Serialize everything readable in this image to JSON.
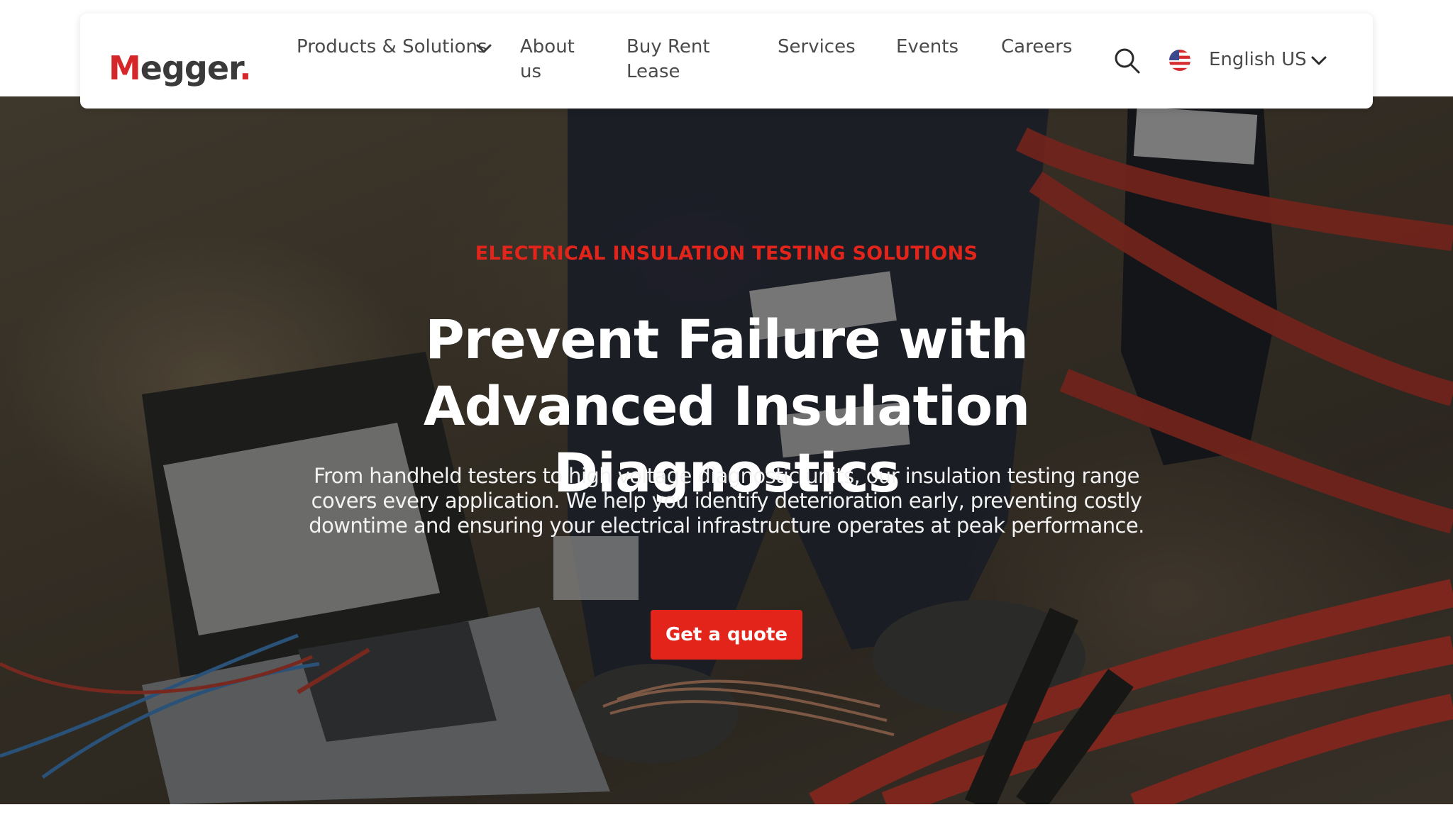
{
  "brand": {
    "logo_first": "M",
    "logo_rest": "egger",
    "logo_dot": ".",
    "accent_color": "#e3241b"
  },
  "nav": {
    "items": [
      {
        "label": "Products & Solutions",
        "has_dropdown": true
      },
      {
        "label_line1": "About",
        "label_line2": "us"
      },
      {
        "label_line1": "Buy Rent",
        "label_line2": "Lease"
      },
      {
        "label": "Services"
      },
      {
        "label": "Events"
      },
      {
        "label": "Careers"
      }
    ],
    "search_icon": "search-icon",
    "language": {
      "flag_icon": "us-flag-icon",
      "label": "English US",
      "dropdown_icon": "chevron-down-icon"
    }
  },
  "hero": {
    "eyebrow": "ELECTRICAL INSULATION TESTING SOLUTIONS",
    "title": "Prevent Failure with Advanced Insulation Diagnostics",
    "description": "From handheld testers to high voltage diagnostic units, our insulation testing range covers every application. We help you identify deterioration early, preventing costly downtime and ensuring your electrical infrastructure operates at peak performance.",
    "cta_label": "Get a quote"
  }
}
